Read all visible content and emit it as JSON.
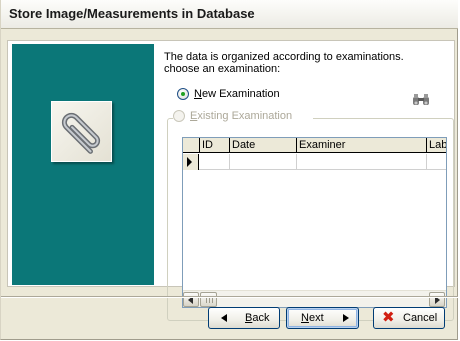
{
  "window": {
    "title": "Store Image/Measurements in Database"
  },
  "side_panel": {
    "background_color": "#0b7778",
    "icon": "paperclip-icon"
  },
  "intro": {
    "line1": "The data is organized according to examinations.",
    "line2": "choose an examination:"
  },
  "options": {
    "new_examination": {
      "label_mnemonic": "N",
      "label_rest": "ew Examination",
      "selected": true,
      "enabled": true
    },
    "existing_examination": {
      "label_mnemonic": "E",
      "label_rest": "xisting Examination",
      "selected": false,
      "enabled": false
    },
    "search_icon": "binoculars-icon"
  },
  "grid": {
    "columns": [
      "ID",
      "Date",
      "Examiner",
      "Lab"
    ],
    "rows": [
      {
        "ID": "",
        "Date": "",
        "Examiner": "",
        "Lab": ""
      }
    ],
    "current_row_indicator": "arrow-right-icon"
  },
  "buttons": {
    "back": {
      "mnemonic": "B",
      "rest": "ack"
    },
    "next": {
      "mnemonic": "N",
      "rest": "ext"
    },
    "cancel": {
      "mnemonic": "",
      "rest": "Cancel"
    }
  },
  "colors": {
    "dialog_bg": "#ece9d8",
    "radio_selected_dot": "#21a121",
    "cancel_icon": "#d11f12",
    "button_border": "#003c74"
  }
}
